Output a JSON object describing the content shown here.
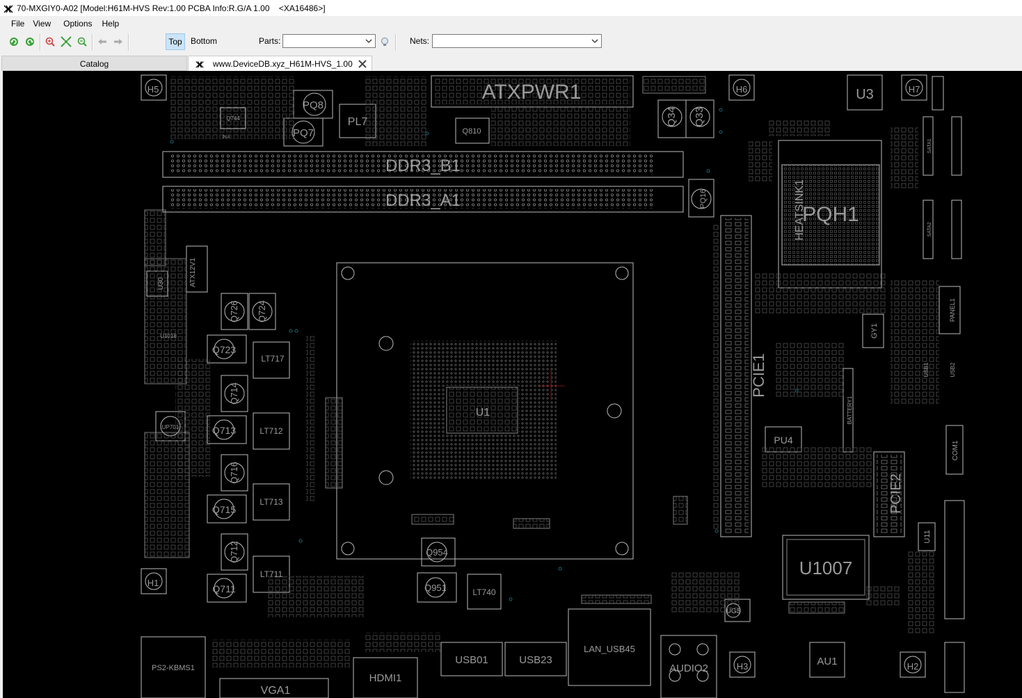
{
  "window": {
    "title": "70-MXGIY0-A02 [Model:H61M-HVS Rev:1.00 PCBA Info:R.G/A 1.00    <XA16486>]"
  },
  "menu": [
    "File",
    "View",
    "Options",
    "Help"
  ],
  "toolbar": {
    "view_top": "Top",
    "view_bottom": "Bottom",
    "parts_label": "Parts:",
    "parts_value": "",
    "nets_label": "Nets:",
    "nets_value": ""
  },
  "tabs": {
    "catalog": "Catalog",
    "board": "www.DeviceDB.xyz_H61M-HVS_1.00"
  },
  "board_labels": {
    "atxpwr": "ATXPWR1",
    "ddr3_b1": "DDR3_B1",
    "ddr3_a1": "DDR3_A1",
    "pl7": "PL7",
    "pq8": "PQ8",
    "pq7": "PQ7",
    "q810": "Q810",
    "q34": "Q34",
    "q33": "Q33",
    "u3": "U3",
    "h5": "H5",
    "h6": "H6",
    "h7": "H7",
    "h1": "H1",
    "h2": "H2",
    "h3": "H3",
    "pqh1": "PQH1",
    "heatsink": "HEATSINK1",
    "pq16": "PQ16",
    "pcie1": "PCIE1",
    "pcie2": "PCIE2",
    "atx12v": "ATX12V1",
    "u30": "U30",
    "u1018": "U1018",
    "q723": "Q723",
    "q724": "Q724",
    "q726": "Q726",
    "q714": "Q714",
    "q713": "Q713",
    "q716": "Q716",
    "q715": "Q715",
    "q712": "Q712",
    "q711": "Q711",
    "lt717": "LT717",
    "lt712": "LT712",
    "lt713": "LT713",
    "lt711": "LT711",
    "up701": "UP701",
    "q954": "Q954",
    "q951": "Q951",
    "lt740": "LT740",
    "pu4": "PU4",
    "battery": "BATTERY1",
    "gy1": "GY1",
    "panel": "PANEL1",
    "u1007": "U1007",
    "u11": "U11",
    "ug5": "UG5",
    "au1": "AU1",
    "com1": "COM1",
    "ps2": "PS2-KBMS1",
    "vga": "VGA1",
    "hdmi": "HDMI1",
    "usb01": "USB01",
    "usb23": "USB23",
    "lan": "LAN_USB45",
    "audio": "AUDIO2",
    "usb1": "USB1",
    "usb2": "USB2",
    "sata1": "SATA1",
    "sata2": "SATA2",
    "pl4": "PL4",
    "q744": "Q744",
    "cpu_u1": "U1"
  },
  "colors": {
    "board_bg": "#000000",
    "silk": "#bdbdbd",
    "label": "#9a9a9a",
    "via": "#1a6a7a",
    "marker": "#7a1010"
  }
}
